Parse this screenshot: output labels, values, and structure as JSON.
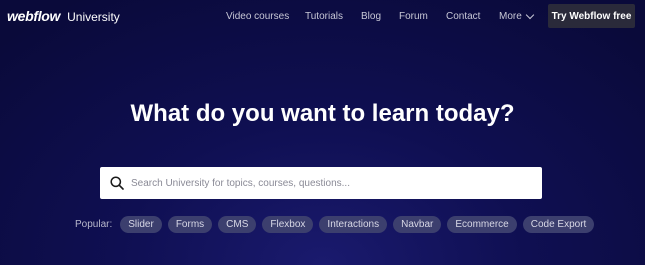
{
  "header": {
    "logo_text": "webflow",
    "logo_sub": "University",
    "nav_items": [
      "Video courses",
      "Tutorials",
      "Blog",
      "Forum",
      "Contact"
    ],
    "more_label": "More",
    "cta_label": "Try Webflow free"
  },
  "hero": {
    "title": "What do you want to learn today?"
  },
  "search": {
    "placeholder": "Search University for topics, courses, questions...",
    "value": ""
  },
  "popular": {
    "label": "Popular:",
    "tags": [
      "Slider",
      "Forms",
      "CMS",
      "Flexbox",
      "Interactions",
      "Navbar",
      "Ecommerce",
      "Code Export"
    ]
  },
  "colors": {
    "background": "#0f0f52",
    "cta_background": "#2a2a3a",
    "tag_background": "#3c3f6e"
  },
  "icons": {
    "search": "search-icon",
    "more": "chevron-down-icon"
  }
}
